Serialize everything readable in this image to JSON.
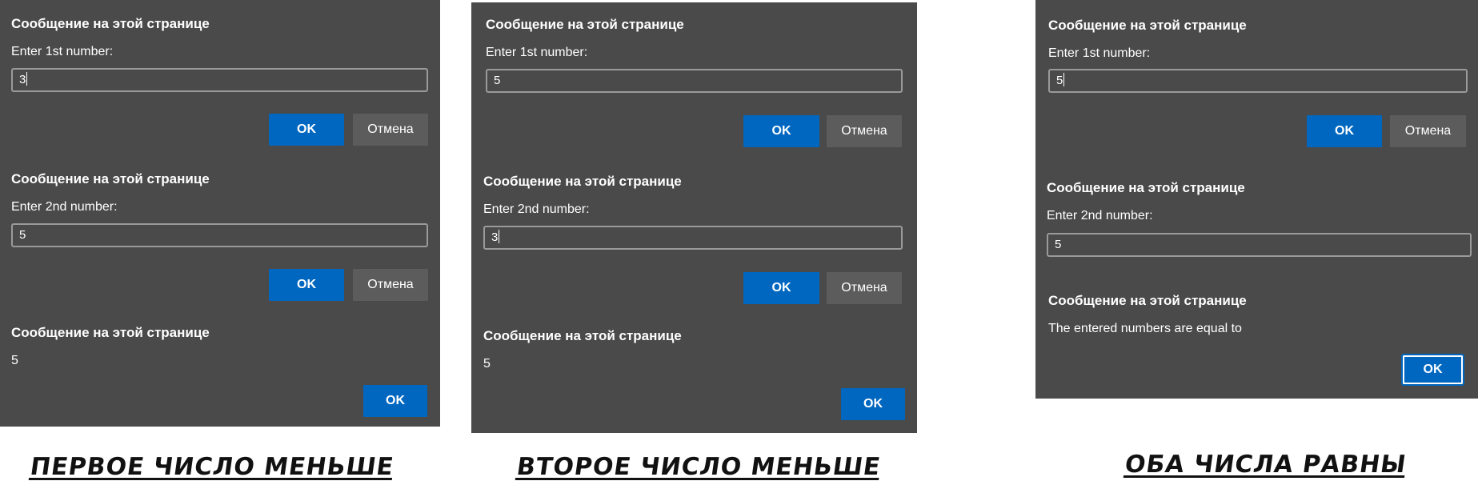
{
  "dialog_title": "Сообщение на этой странице",
  "ok_label": "OK",
  "cancel_label": "Отмена",
  "panels": [
    {
      "prompt1": {
        "message": "Enter 1st number:",
        "value": "3"
      },
      "prompt2": {
        "message": "Enter 2nd number:",
        "value": "5"
      },
      "alert": {
        "message": "5"
      },
      "caption": "ПЕРВОЕ ЧИСЛО МЕНЬШЕ"
    },
    {
      "prompt1": {
        "message": "Enter 1st number:",
        "value": "5"
      },
      "prompt2": {
        "message": "Enter 2nd number:",
        "value": "3"
      },
      "alert": {
        "message": "5"
      },
      "caption": "ВТОРОЕ ЧИСЛО МЕНЬШЕ"
    },
    {
      "prompt1": {
        "message": "Enter 1st number:",
        "value": "5"
      },
      "prompt2": {
        "message": "Enter 2nd number:",
        "value": "5"
      },
      "alert": {
        "message": "The entered numbers are equal to"
      },
      "caption": "ОБА ЧИСЛА РАВНЫ"
    }
  ],
  "colors": {
    "dialog_bg": "#4a4a4a",
    "accent": "#0067c0",
    "cancel_bg": "#5c5c5c",
    "text": "#ffffff"
  }
}
